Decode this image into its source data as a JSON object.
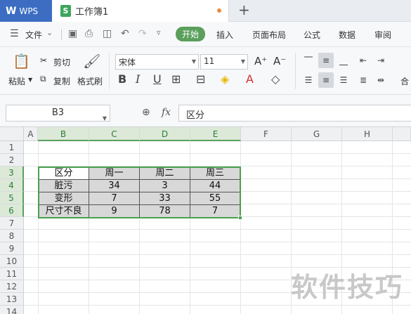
{
  "app": {
    "name": "WPS"
  },
  "document": {
    "title": "工作簿1"
  },
  "menu": {
    "file": "文件",
    "items": [
      "开始",
      "插入",
      "页面布局",
      "公式",
      "数据",
      "审阅"
    ],
    "active": "开始"
  },
  "ribbon": {
    "paste": "粘贴",
    "cut": "剪切",
    "copy": "复制",
    "format_painter": "格式刷",
    "font_name": "宋体",
    "font_size": "11",
    "merge_partial": "合"
  },
  "formula_bar": {
    "cell_ref": "B3",
    "fx": "fx",
    "content": "区分"
  },
  "sheet": {
    "columns": [
      "A",
      "B",
      "C",
      "D",
      "E",
      "F",
      "G",
      "H"
    ],
    "rows": [
      "1",
      "2",
      "3",
      "4",
      "5",
      "6",
      "7",
      "8",
      "9",
      "10",
      "11",
      "12",
      "13",
      "14"
    ],
    "table": {
      "header": [
        "区分",
        "周一",
        "周二",
        "周三"
      ],
      "rows": [
        [
          "脏污",
          "34",
          "3",
          "44"
        ],
        [
          "变形",
          "7",
          "33",
          "55"
        ],
        [
          "尺寸不良",
          "9",
          "78",
          "7"
        ]
      ]
    }
  },
  "watermark": "软件技巧",
  "colors": {
    "accent": "#5aa05c",
    "wps_tab": "#3c6dc2",
    "selection": "#4aa04e"
  }
}
